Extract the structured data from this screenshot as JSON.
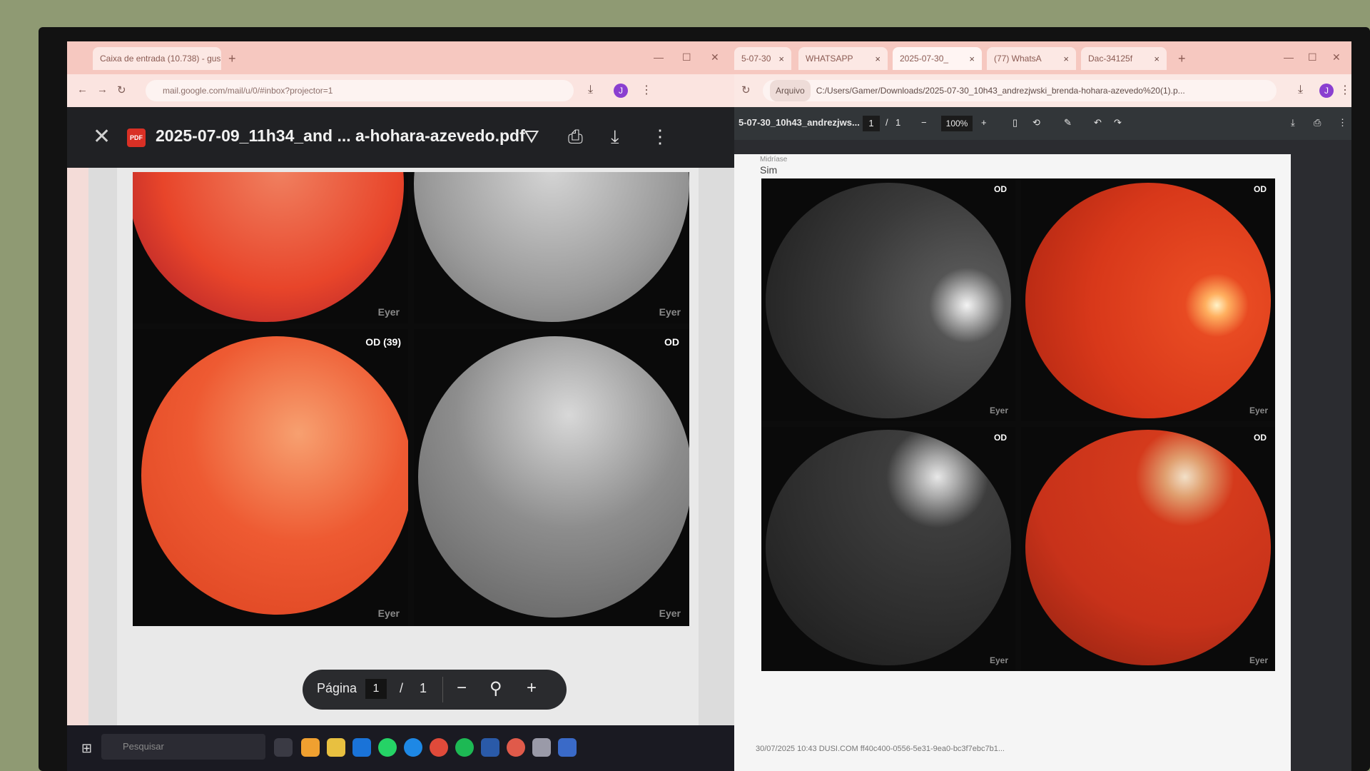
{
  "left_browser": {
    "tab_title": "Caixa de entrada (10.738) - gus",
    "tab_close": "×",
    "new_tab": "+",
    "url": "mail.google.com/mail/u/0/#inbox?projector=1",
    "pdf_title": "2025-07-09_11h34_and ... a-hohara-azevedo.pdf",
    "pdf_badge": "PDF",
    "close_glyph": "✕",
    "page_label": "Página",
    "page_current": "1",
    "page_sep": "/",
    "page_total": "1",
    "zoom_out": "−",
    "zoom_in": "+",
    "zoom_glyph": "⚲",
    "images": [
      {
        "label": "",
        "watermark": "Eyer",
        "color": "#e8452a"
      },
      {
        "label": "",
        "watermark": "Eyer",
        "color": "#9a9a9a"
      },
      {
        "label": "OD (39)",
        "watermark": "Eyer",
        "color": "#ee5a32"
      },
      {
        "label": "OD",
        "watermark": "Eyer",
        "color": "#8d8d8d"
      }
    ]
  },
  "taskbar": {
    "search_placeholder": "Pesquisar",
    "start_glyph": "⊞",
    "search_glyph": "⚲"
  },
  "right_browser": {
    "tabs": [
      "5-07-30",
      "WHATSAPP",
      "2025-07-30_",
      "(77) WhatsA",
      "Dac-34125f"
    ],
    "tab_close": "×",
    "new_tab": "+",
    "url_chip": "Arquivo",
    "url": "C:/Users/Gamer/Downloads/2025-07-30_10h43_andrezjwski_brenda-hohara-azevedo%20(1).p...",
    "pdf_filename": "5-07-30_10h43_andrezjws...",
    "page_current": "1",
    "page_sep": "/",
    "page_total": "1",
    "zoom_out": "−",
    "zoom": "100%",
    "zoom_in": "+",
    "midriase_label": "Midríase",
    "midriase_value": "Sim",
    "images": [
      {
        "label": "OD",
        "watermark": "Eyer",
        "color": "#3a3a3a"
      },
      {
        "label": "OD",
        "watermark": "Eyer",
        "color": "#d8381a"
      },
      {
        "label": "OD",
        "watermark": "Eyer",
        "color": "#3d3d3d"
      },
      {
        "label": "OD",
        "watermark": "Eyer",
        "color": "#d43a1c"
      }
    ],
    "footer": "30/07/2025   10:43   DUSI.COM   ff40c400-0556-5e31-9ea0-bc3f7ebc7b1..."
  }
}
